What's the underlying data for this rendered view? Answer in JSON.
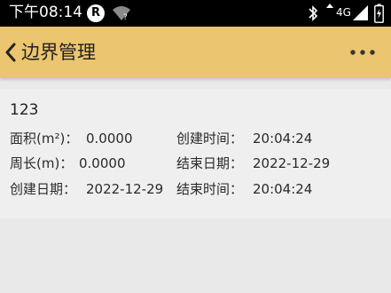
{
  "status_bar": {
    "time": "下午08:14",
    "app_badge": "R",
    "wifi_mark": "?",
    "network": "4G"
  },
  "header": {
    "title": "边界管理"
  },
  "record": {
    "name": "123",
    "area_label": "面积(m²)：",
    "area_value": "0.0000",
    "create_time_label": "创建时间：",
    "create_time_value": "20:04:24",
    "perimeter_label": "周长(m)：",
    "perimeter_value": "0.0000",
    "end_date_label": "结束日期：",
    "end_date_value": "2022-12-29",
    "create_date_label": "创建日期：",
    "create_date_value": "2022-12-29",
    "end_time_label": "结束时间：",
    "end_time_value": "20:04:24"
  },
  "colors": {
    "header_bg": "#ebc56f",
    "page_bg": "#e9e9e9",
    "card_bg": "#efefef"
  },
  "icons": [
    "back-chevron-icon",
    "more-icon",
    "bluetooth-icon",
    "signal-icon",
    "battery-icon",
    "wifi-icon"
  ]
}
